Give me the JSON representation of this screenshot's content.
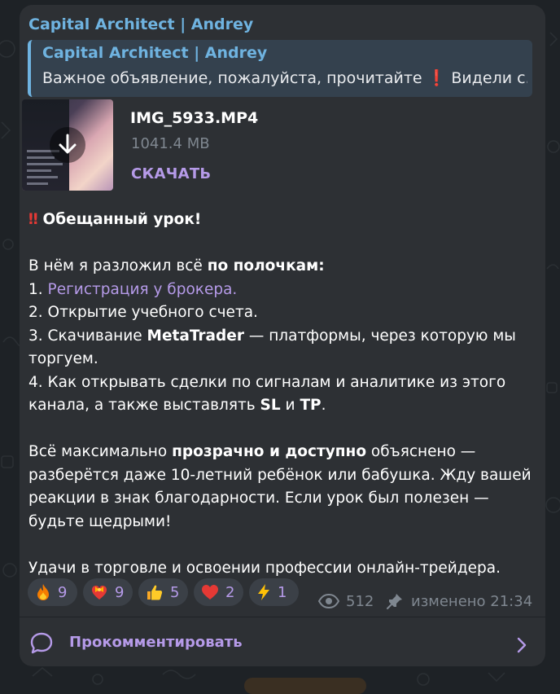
{
  "channel": {
    "name": "Capital Architect | Andrey"
  },
  "reply": {
    "title": "Capital Architect | Andrey",
    "text": "Важное объявление, пожалуйста, прочитайте",
    "mark": "❗",
    "text_tail": "Видели с..."
  },
  "attachment": {
    "file_name": "IMG_5933.MP4",
    "file_size": "1041.4 MB",
    "download_label": "СКАЧАТЬ"
  },
  "message": {
    "headline_mark": "‼",
    "headline": "Обещанный урок!",
    "intro_prefix": "В нём я разложил всё ",
    "intro_bold": "по полочкам:",
    "item1_prefix": " 1. ",
    "item1_link": "Регистрация у брокера.",
    "item2": " 2. Открытие учебного счета.",
    "item3_prefix": " 3. Скачивание ",
    "item3_bold": "MetaTrader",
    "item3_suffix": " — платформы, через которую мы торгуем.",
    "item4_prefix": " 4. Как открывать сделки по сигналам и аналитике из этого канала, а также выставлять ",
    "item4_bold1": "SL",
    "item4_mid": " и ",
    "item4_bold2": "TP",
    "item4_end": ".",
    "para_prefix": "Всё максимально ",
    "para_bold": "прозрачно и доступно",
    "para_suffix": " объяснено — разберётся даже 10-летний ребёнок или бабушка. Жду вашей реакции в знак благодарности. Если урок был полезен — будьте щедрыми!",
    "closing": "Удачи в торговле и освоении профессии онлайн-трейдера."
  },
  "reactions": [
    {
      "icon": "fire-icon",
      "count": "9"
    },
    {
      "icon": "heart-bow-icon",
      "count": "9"
    },
    {
      "icon": "thumbs-up-icon",
      "count": "5"
    },
    {
      "icon": "red-heart-icon",
      "count": "2"
    },
    {
      "icon": "lightning-icon",
      "count": "1"
    }
  ],
  "meta": {
    "views": "512",
    "edited": "изменено 21:34"
  },
  "comments": {
    "label": "Прокомментировать"
  },
  "colors": {
    "accent": "#b59ae8",
    "channel": "#6fb3e0",
    "bubble": "#2d3034",
    "reaction_bg": "#3b4047"
  }
}
